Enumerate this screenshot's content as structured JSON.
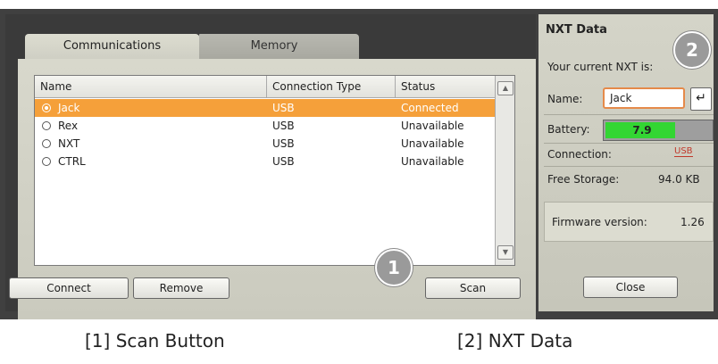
{
  "tabs": [
    {
      "label": "Communications",
      "active": true
    },
    {
      "label": "Memory",
      "active": false
    }
  ],
  "table": {
    "columns": [
      "Name",
      "Connection Type",
      "Status"
    ],
    "rows": [
      {
        "name": "Jack",
        "type": "USB",
        "status": "Connected",
        "selected": true
      },
      {
        "name": "Rex",
        "type": "USB",
        "status": "Unavailable",
        "selected": false
      },
      {
        "name": "NXT",
        "type": "USB",
        "status": "Unavailable",
        "selected": false
      },
      {
        "name": "CTRL",
        "type": "USB",
        "status": "Unavailable",
        "selected": false
      }
    ]
  },
  "buttons": {
    "connect": "Connect",
    "remove": "Remove",
    "scan": "Scan",
    "close": "Close"
  },
  "nxt": {
    "title": "NXT Data",
    "current_label": "Your current NXT is:",
    "name_label": "Name:",
    "name_value": "Jack",
    "battery_label": "Battery:",
    "battery_value": "7.9",
    "battery_fraction": 0.66,
    "connection_label": "Connection:",
    "connection_icon": "usb-icon",
    "connection_icon_text": "USB",
    "storage_label": "Free Storage:",
    "storage_value": "94.0 KB",
    "firmware_label": "Firmware version:",
    "firmware_value": "1.26"
  },
  "callouts": {
    "one": "1",
    "two": "2"
  },
  "captions": {
    "one": "[1] Scan Button",
    "two": "[2] NXT Data"
  },
  "colors": {
    "selection": "#f5a03a",
    "battery": "#33d633",
    "name_border": "#e58a4a"
  }
}
